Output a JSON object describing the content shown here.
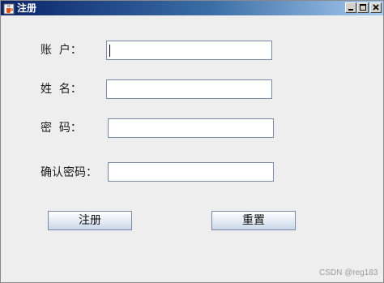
{
  "window": {
    "title": "注册"
  },
  "form": {
    "account_label": "账  户：",
    "name_label": "姓  名：",
    "password_label": "密  码：",
    "confirm_label": "确认密码：",
    "account_value": "",
    "name_value": "",
    "password_value": "",
    "confirm_value": ""
  },
  "buttons": {
    "register_label": "注册",
    "reset_label": "重置"
  },
  "watermark": "CSDN @reg183",
  "icons": {
    "app": "java-cup-icon",
    "minimize": "minimize-icon",
    "maximize": "maximize-icon",
    "close": "close-icon"
  },
  "colors": {
    "titlebar_start": "#0a246a",
    "titlebar_end": "#a6caf0",
    "window_bg": "#eeeeee",
    "field_border": "#7a8aa6"
  }
}
